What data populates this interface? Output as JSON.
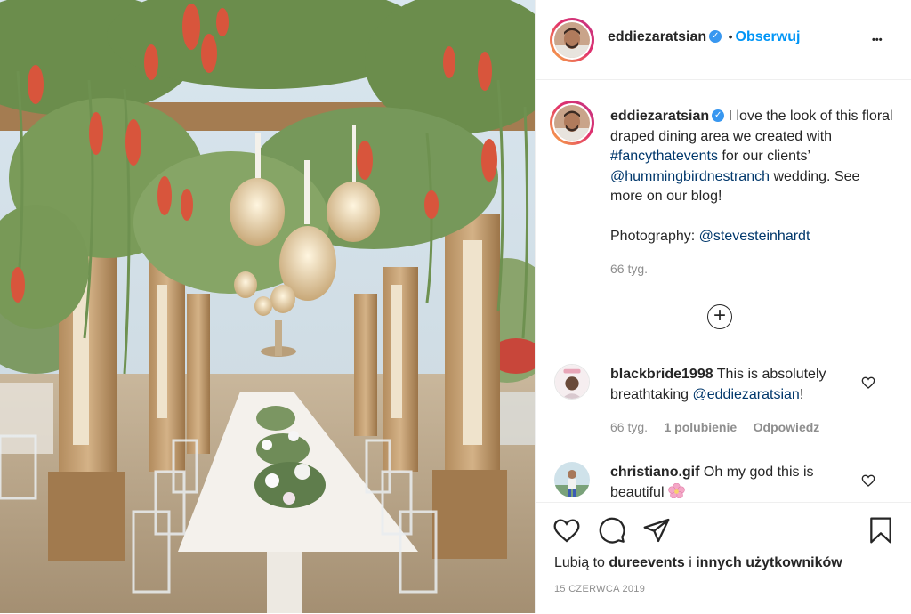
{
  "post": {
    "image_alt": "Floral draped dining area with chandeliers under a wooden pergola",
    "author": "eddiezaratsian",
    "follow_label": "Obserwuj",
    "separator": "•",
    "more_label": "•••"
  },
  "caption": {
    "username": "eddiezaratsian",
    "text_1": "I love the look of this floral draped dining area we created with",
    "hashtag": "#fancythatevents",
    "text_2": "for our clients’",
    "mention": "@hummingbirdnestranch",
    "text_3": "wedding. See more on our blog!",
    "photo_label": "Photography:",
    "photo_mention": "@stevesteinhardt",
    "time": "66 tyg."
  },
  "load_more_label": "+",
  "comments": [
    {
      "username": "blackbride1998",
      "text": "This is absolutely breathtaking",
      "mention": "@eddiezaratsian",
      "text_end": "!",
      "time": "66 tyg.",
      "likes": "1 polubienie",
      "reply": "Odpowiedz"
    },
    {
      "username": "christiano.gif",
      "text": "Oh my god this is beautiful"
    }
  ],
  "likes_line": {
    "prefix": "Lubią to",
    "user": "dureevents",
    "middle": "i",
    "others": "innych użytkowników"
  },
  "date": "15 CZERWCA 2019",
  "colors": {
    "link": "#00376b",
    "follow": "#0095f6",
    "verified": "#3897f0",
    "muted": "#8e8e8e"
  }
}
